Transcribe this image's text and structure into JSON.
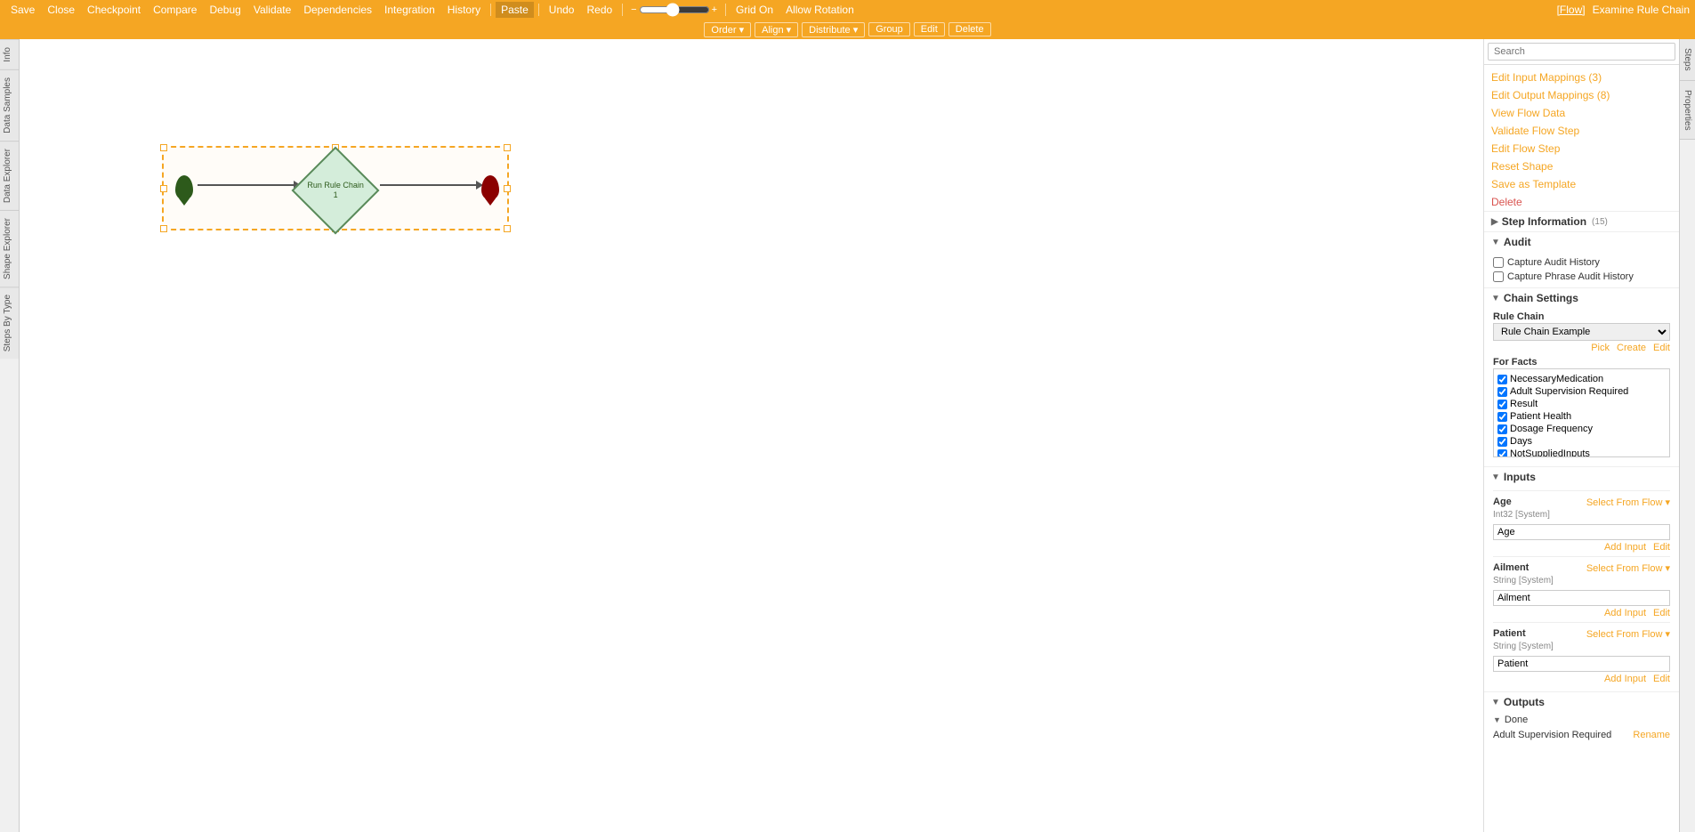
{
  "toolbar": {
    "save": "Save",
    "close": "Close",
    "checkpoint": "Checkpoint",
    "compare": "Compare",
    "debug": "Debug",
    "validate": "Validate",
    "dependencies": "Dependencies",
    "integration": "Integration",
    "history": "History",
    "paste": "Paste",
    "undo": "Undo",
    "redo": "Redo",
    "zoom_minus": "−",
    "zoom_plus": "+",
    "grid_on": "Grid On",
    "allow_rotation": "Allow Rotation",
    "flow_label": "[Flow]",
    "examine": "Examine Rule Chain"
  },
  "shape_toolbar": {
    "order": "Order",
    "align": "Align",
    "distribute": "Distribute",
    "group": "Group",
    "edit": "Edit",
    "delete": "Delete"
  },
  "left_tabs": [
    "Info",
    "Data Samples",
    "Data Explorer",
    "Shape Explorer",
    "Steps By Type"
  ],
  "flow_node": {
    "label": "Run Rule Chain 1"
  },
  "right_panel": {
    "search_placeholder": "Search",
    "tabs": [
      "Steps",
      "Properties"
    ],
    "context_menu": [
      {
        "id": "edit-input-mappings",
        "label": "Edit Input Mappings (3)"
      },
      {
        "id": "edit-output-mappings",
        "label": "Edit Output Mappings (8)"
      },
      {
        "id": "view-flow-data",
        "label": "View Flow Data"
      },
      {
        "id": "validate-flow-step",
        "label": "Validate Flow Step"
      },
      {
        "id": "edit-flow-step",
        "label": "Edit Flow Step"
      },
      {
        "id": "reset-shape",
        "label": "Reset Shape"
      },
      {
        "id": "save-as-template",
        "label": "Save as Template"
      },
      {
        "id": "delete",
        "label": "Delete",
        "red": true
      }
    ],
    "step_information": {
      "label": "Step Information",
      "badge": "(15)"
    },
    "audit": {
      "label": "Audit",
      "capture_audit": "Capture Audit History",
      "capture_phrase": "Capture Phrase Audit History"
    },
    "chain_settings": {
      "label": "Chain Settings",
      "rule_chain_label": "Rule Chain",
      "rule_chain_value": "Rule Chain Example",
      "pick": "Pick",
      "create": "Create",
      "edit": "Edit",
      "for_facts_label": "For Facts",
      "facts": [
        {
          "label": "NecessaryMedication",
          "checked": true
        },
        {
          "label": "Adult Supervision Required",
          "checked": true
        },
        {
          "label": "Result",
          "checked": true
        },
        {
          "label": "Patient Health",
          "checked": true
        },
        {
          "label": "Dosage Frequency",
          "checked": true
        },
        {
          "label": "Days",
          "checked": true
        },
        {
          "label": "NotSuppliedInputs",
          "checked": true
        }
      ]
    },
    "inputs": {
      "label": "Inputs",
      "items": [
        {
          "name": "Age",
          "type": "Int32 [System]",
          "select_from_flow": "Select From Flow",
          "value": "Age",
          "add_input": "Add Input",
          "edit": "Edit"
        },
        {
          "name": "Ailment",
          "type": "String [System]",
          "select_from_flow": "Select From Flow",
          "value": "Ailment",
          "add_input": "Add Input",
          "edit": "Edit"
        },
        {
          "name": "Patient",
          "type": "String [System]",
          "select_from_flow": "Select From Flow",
          "value": "Patient",
          "add_input": "Add Input",
          "edit": "Edit"
        }
      ]
    },
    "outputs": {
      "label": "Outputs",
      "done_label": "Done",
      "adult_supervision": "Adult Supervision Required",
      "rename": "Rename"
    }
  },
  "vertical_right_tabs": [
    "Steps",
    "Properties"
  ]
}
